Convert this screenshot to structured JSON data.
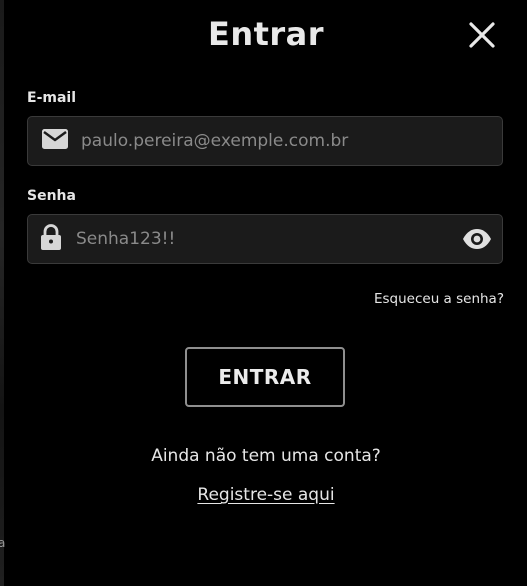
{
  "backdrop": {
    "edge_letter": "a"
  },
  "modal": {
    "title": "Entrar",
    "close_icon": "close-x-icon"
  },
  "email": {
    "label": "E-mail",
    "value": "",
    "placeholder": "paulo.pereira@exemple.com.br",
    "icon": "envelope-icon"
  },
  "password": {
    "label": "Senha",
    "value": "",
    "placeholder": "Senha123!!",
    "icon": "lock-icon",
    "toggle_icon": "eye-icon"
  },
  "forgot_password": "Esqueceu a senha?",
  "submit_label": "ENTRAR",
  "no_account_text": "Ainda não tem uma conta?",
  "register_link": "Registre-se aqui",
  "colors": {
    "background": "#000000",
    "field_bg": "#1b1b1b",
    "field_border": "#3a3a3a",
    "text": "#e6e6e6",
    "placeholder": "#8a8a8a",
    "button_border": "#8f8f8f"
  }
}
